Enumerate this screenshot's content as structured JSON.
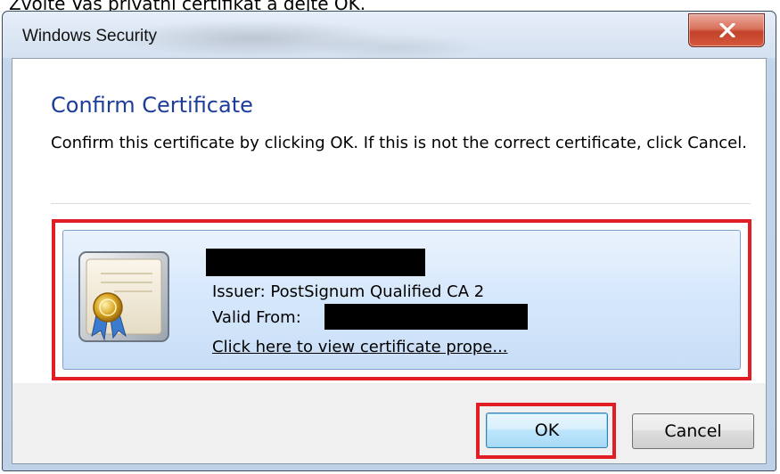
{
  "caption": {
    "text": "Zvolte Váš privátní certifikát a dejte OK."
  },
  "window": {
    "title": "Windows Security",
    "close_symbol": "X"
  },
  "dialog": {
    "heading": "Confirm Certificate",
    "message": "Confirm this certificate by clicking OK. If this is not the correct certificate, click Cancel."
  },
  "certificate": {
    "issuer": "Issuer: PostSignum Qualified CA 2",
    "valid_from_label": "Valid From:",
    "view_link": "Click here to view certificate prope...",
    "icon": "certificate-icon"
  },
  "buttons": {
    "ok": "OK",
    "cancel": "Cancel"
  },
  "colors": {
    "heading": "#1c3d99",
    "highlight": "#e11e25",
    "close_button": "#c4412a"
  }
}
